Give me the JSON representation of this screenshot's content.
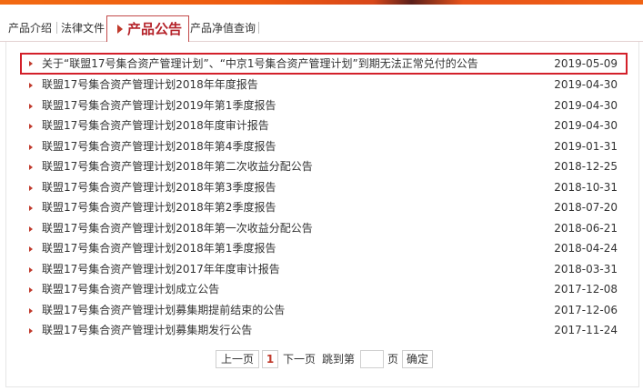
{
  "tabs": {
    "items": [
      {
        "label": "产品介绍"
      },
      {
        "label": "法律文件"
      },
      {
        "label": "产品公告"
      },
      {
        "label": "产品净值查询"
      }
    ]
  },
  "announcements": [
    {
      "title": "关于“联盟17号集合资产管理计划”、“中京1号集合资产管理计划”到期无法正常兑付的公告",
      "date": "2019-05-09"
    },
    {
      "title": "联盟17号集合资产管理计划2018年年度报告",
      "date": "2019-04-30"
    },
    {
      "title": "联盟17号集合资产管理计划2019年第1季度报告",
      "date": "2019-04-30"
    },
    {
      "title": "联盟17号集合资产管理计划2018年度审计报告",
      "date": "2019-04-30"
    },
    {
      "title": "联盟17号集合资产管理计划2018年第4季度报告",
      "date": "2019-01-31"
    },
    {
      "title": "联盟17号集合资产管理计划2018年第二次收益分配公告",
      "date": "2018-12-25"
    },
    {
      "title": "联盟17号集合资产管理计划2018年第3季度报告",
      "date": "2018-10-31"
    },
    {
      "title": "联盟17号集合资产管理计划2018年第2季度报告",
      "date": "2018-07-20"
    },
    {
      "title": "联盟17号集合资产管理计划2018年第一次收益分配公告",
      "date": "2018-06-21"
    },
    {
      "title": "联盟17号集合资产管理计划2018年第1季度报告",
      "date": "2018-04-24"
    },
    {
      "title": "联盟17号集合资产管理计划2017年年度审计报告",
      "date": "2018-03-31"
    },
    {
      "title": "联盟17号集合资产管理计划成立公告",
      "date": "2017-12-08"
    },
    {
      "title": "联盟17号集合资产管理计划募集期提前结束的公告",
      "date": "2017-12-06"
    },
    {
      "title": "联盟17号集合资产管理计划募集期发行公告",
      "date": "2017-11-24"
    }
  ],
  "pager": {
    "prev_label": "上一页",
    "current_page": "1",
    "next_label": "下一页",
    "jump_label": "跳到第",
    "jump_value": "",
    "page_suffix": "页",
    "confirm_label": "确定"
  },
  "colors": {
    "accent": "#b5232a",
    "highlight_border": "#d3202a",
    "banner": "#f06213"
  }
}
